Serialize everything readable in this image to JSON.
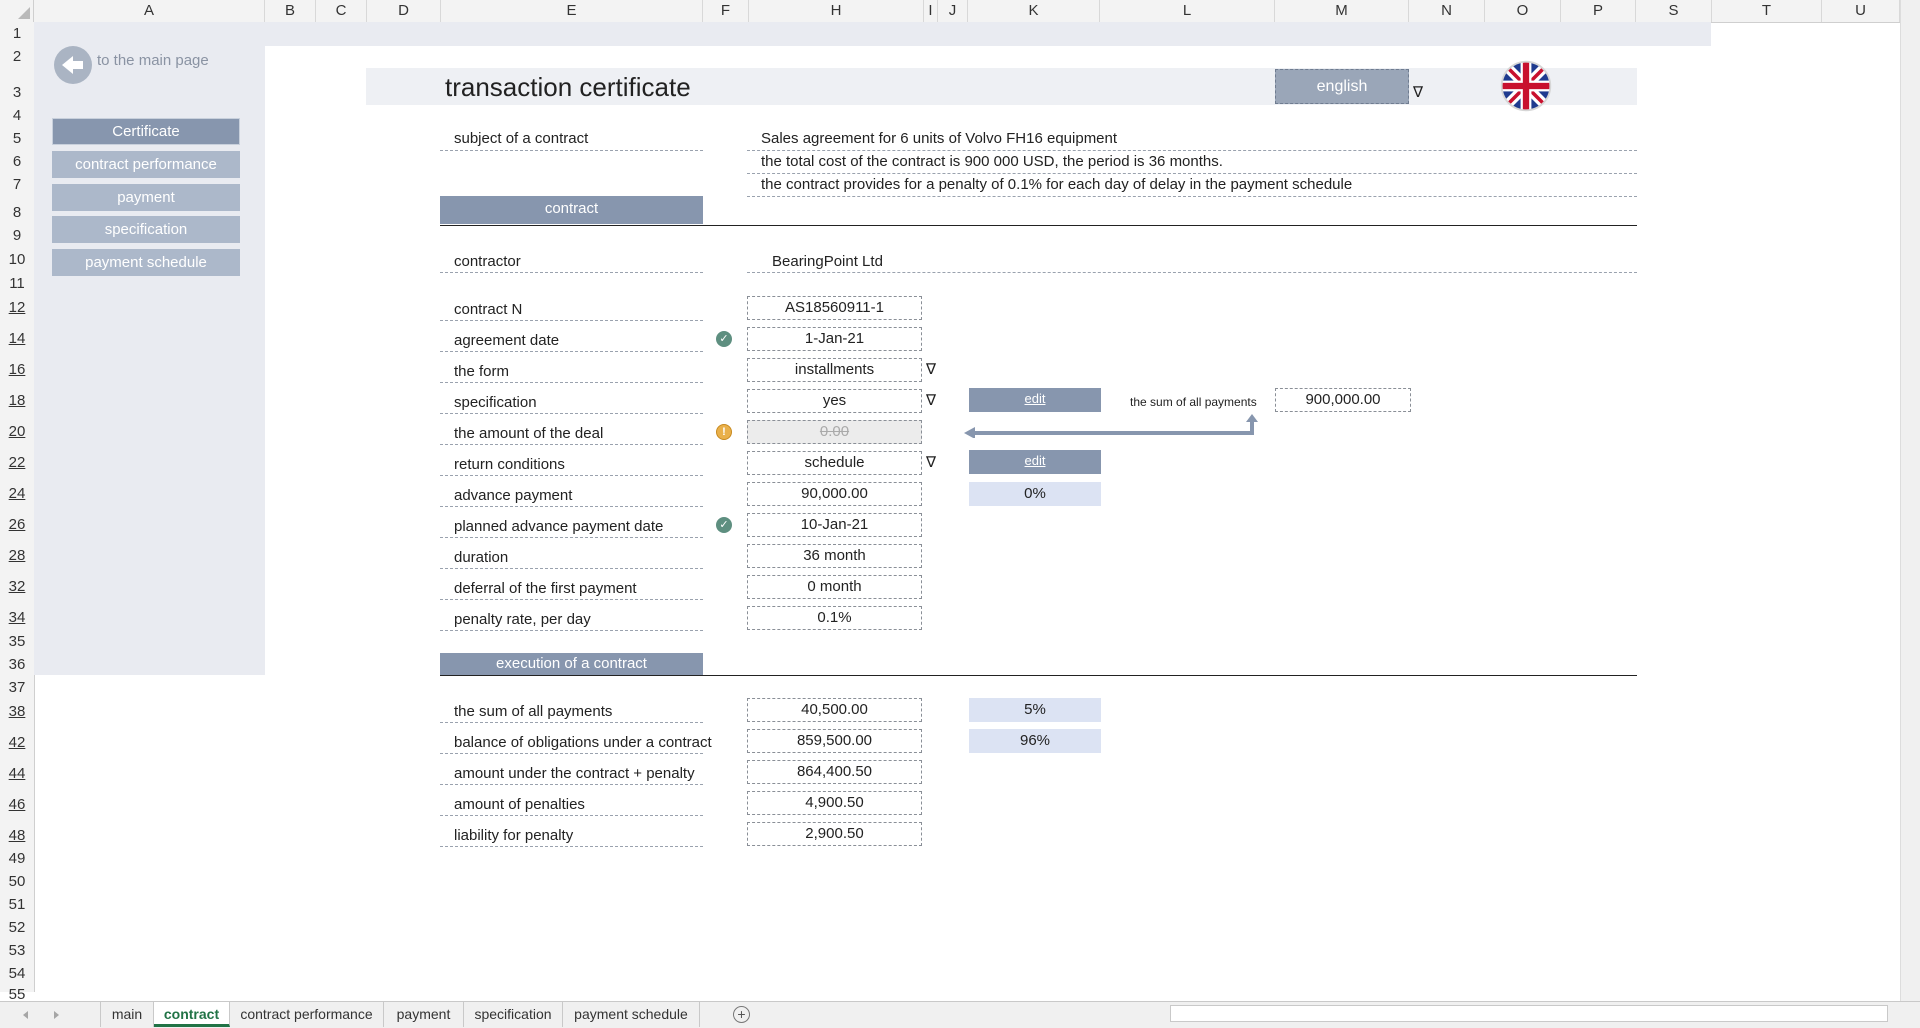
{
  "columns": [
    "A",
    "B",
    "C",
    "D",
    "E",
    "F",
    "H",
    "I",
    "J",
    "K",
    "L",
    "M",
    "N",
    "O",
    "P",
    "S",
    "T",
    "U"
  ],
  "rows": [
    "1",
    "2",
    "3",
    "4",
    "5",
    "6",
    "7",
    "8",
    "9",
    "10",
    "11",
    "12",
    "14",
    "16",
    "18",
    "20",
    "22",
    "24",
    "26",
    "28",
    "32",
    "34",
    "35",
    "36",
    "37",
    "38",
    "42",
    "44",
    "46",
    "48",
    "49",
    "50",
    "51",
    "52",
    "53",
    "54",
    "55"
  ],
  "nav": {
    "back_label": "to the main page",
    "items": [
      "Certificate",
      "contract performance",
      "payment",
      "specification",
      "payment schedule"
    ]
  },
  "title": "transaction certificate",
  "language": "english",
  "subject": {
    "label": "subject of a contract",
    "lines": [
      "Sales agreement for 6 units of Volvo FH16 equipment",
      "the total cost of the contract is 900 000 USD, the period is 36 months.",
      "the contract provides for a penalty of 0.1% for each day of delay in the payment schedule"
    ]
  },
  "section_contract": "contract",
  "contractor": {
    "label": "contractor",
    "value": "BearingPoint Ltd"
  },
  "fields": [
    {
      "label": "contract N",
      "value": "AS18560911-1"
    },
    {
      "label": "agreement date",
      "value": "1-Jan-21"
    },
    {
      "label": "the form",
      "value": "installments"
    },
    {
      "label": "specification",
      "value": "yes"
    },
    {
      "label": "the amount of the deal",
      "value": "0.00"
    },
    {
      "label": "return conditions",
      "value": "schedule"
    },
    {
      "label": "advance payment",
      "value": "90,000.00"
    },
    {
      "label": "planned  advance payment date",
      "value": "10-Jan-21"
    },
    {
      "label": "duration",
      "value": "36 month"
    },
    {
      "label": "deferral of the first payment",
      "value": "0 month"
    },
    {
      "label": "penalty rate, per day",
      "value": "0.1%"
    }
  ],
  "edit_label": "edit",
  "advance_pct": "0%",
  "sum_all": {
    "label": "the sum of all payments",
    "value": "900,000.00"
  },
  "section_execution": "execution of a contract",
  "execution": [
    {
      "label": "the sum of all payments",
      "value": "40,500.00",
      "pct": "5%"
    },
    {
      "label": "balance of obligations under a contract",
      "value": "859,500.00",
      "pct": "96%"
    },
    {
      "label": "amount under the contract + penalty",
      "value": "864,400.50"
    },
    {
      "label": "amount of penalties",
      "value": "4,900.50"
    },
    {
      "label": "liability for penalty",
      "value": "2,900.50"
    }
  ],
  "tabs": [
    "main",
    "contract",
    "contract performance",
    "payment",
    "specification",
    "payment schedule"
  ],
  "dropdown_glyph": "∇",
  "check_glyph": "✓",
  "warn_glyph": "!",
  "add_sheet_glyph": "+",
  "colors": {
    "accent": "#8796ae",
    "nav": "#acb8ca",
    "panel": "#e9ebf1",
    "pct_bg": "#dce3f3",
    "check": "#5e8f80",
    "warn": "#e9b04a",
    "tab_active": "#217346"
  }
}
